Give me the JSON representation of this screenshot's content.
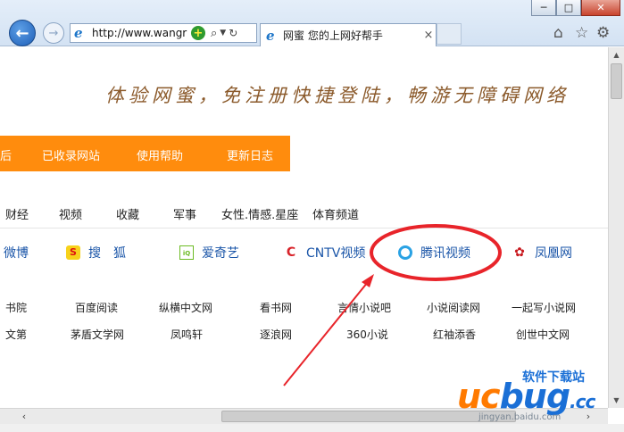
{
  "browser": {
    "address_url": "http://www.wangr",
    "tab_title": "网蜜 您的上网好帮手",
    "tab_close": "×",
    "window_buttons": [
      "─",
      "□",
      "✕"
    ],
    "toolbar_icons": [
      "home-icon",
      "star-icon",
      "gear-icon"
    ]
  },
  "page": {
    "slogan": "体验网蜜，免注册快捷登陆，畅游无障碍网络",
    "orange_nav": [
      "后",
      "已收录网站",
      "使用帮助",
      "更新日志"
    ],
    "categories": [
      "财经",
      "视频",
      "收藏",
      "军事",
      "女性.情感.星座",
      "体育频道"
    ],
    "sites": [
      {
        "label": "微博",
        "icon": "weibo-icon"
      },
      {
        "label": "搜　狐",
        "icon": "sohu-icon"
      },
      {
        "label": "爱奇艺",
        "icon": "iqiyi-icon"
      },
      {
        "label": "CNTV视频",
        "icon": "cntv-icon"
      },
      {
        "label": "腾讯视频",
        "icon": "tencent-video-icon"
      },
      {
        "label": "凤凰网",
        "icon": "ifeng-icon"
      }
    ],
    "links_row1": [
      "书院",
      "百度阅读",
      "纵横中文网",
      "看书网",
      "言情小说吧",
      "小说阅读网",
      "一起写小说网"
    ],
    "links_row2": [
      "文第",
      "茅盾文学网",
      "凤鸣轩",
      "逐浪网",
      "360小说",
      "红袖添香",
      "创世中文网"
    ]
  },
  "watermark": {
    "top": "软件下载站",
    "logo_uc": "uc",
    "logo_bug": "bug",
    "logo_cc": ".cc",
    "url": "jingyan.baidu.com"
  },
  "colors": {
    "orange_nav": "#ff8c0d",
    "annotation_red": "#e8242a",
    "link_blue": "#1a55a8"
  }
}
